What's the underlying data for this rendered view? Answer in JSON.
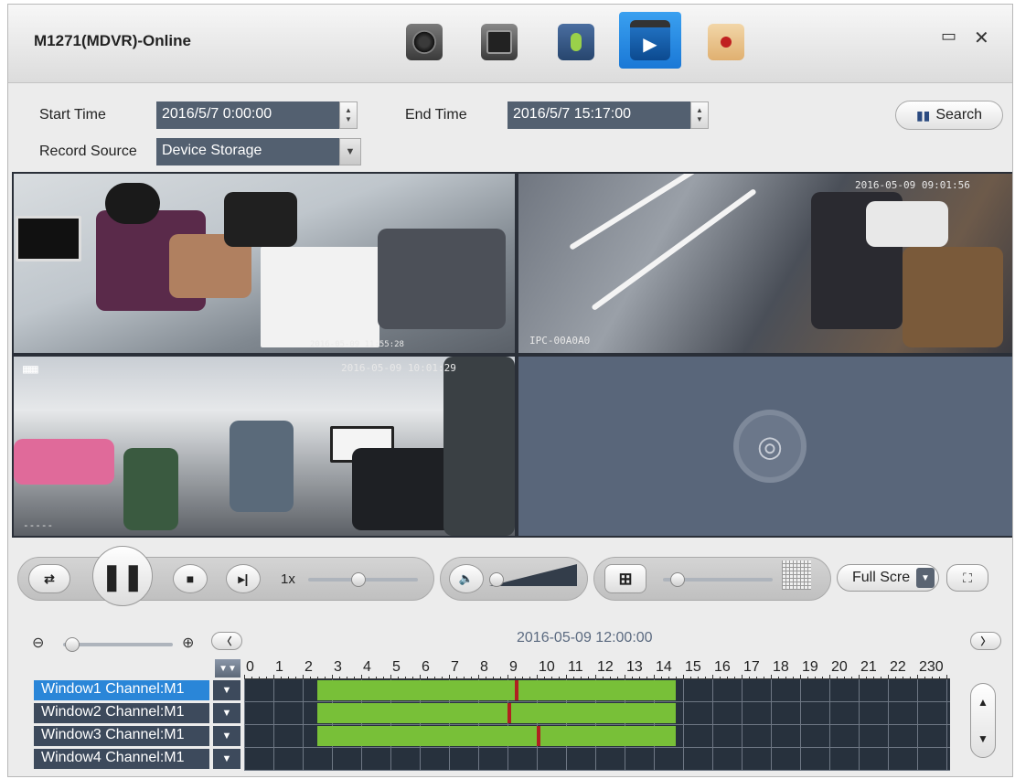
{
  "window": {
    "title": "M1271(MDVR)-Online",
    "maximize_glyph": "▭",
    "close_glyph": "✕"
  },
  "toolbar": {
    "icons": [
      "camera-icon",
      "monitor-icon",
      "microphone-icon",
      "playback-icon",
      "map-icon"
    ],
    "active": "playback-icon"
  },
  "search": {
    "start_label": "Start Time",
    "start_value": "2016/5/7 0:00:00",
    "end_label": "End Time",
    "end_value": "2016/5/7 15:17:00",
    "source_label": "Record Source",
    "source_value": "Device Storage",
    "search_button": "Search"
  },
  "video": {
    "pane1_osd": "2016-05-09 11:55:28",
    "pane2_osd_top": "2016-05-09 09:01:56",
    "pane2_osd_bottom": "IPC-00A0A0",
    "pane3_osd_top": "2016-05-09 10:01:29",
    "pane3_osd_bottom": "-----"
  },
  "controls": {
    "speed_label": "1x",
    "fullscreen_select": "Full Scre",
    "speed_level": 0.45,
    "volume_level": 0.0,
    "zoom_level": 0.08
  },
  "timeline": {
    "datetime": "2016-05-09 12:00:00",
    "hours": [
      "0",
      "1",
      "2",
      "3",
      "4",
      "5",
      "6",
      "7",
      "8",
      "9",
      "10",
      "11",
      "12",
      "13",
      "14",
      "15",
      "16",
      "17",
      "18",
      "19",
      "20",
      "21",
      "22",
      "230"
    ],
    "channels": [
      {
        "label": "Window1 Channel:M1",
        "selected": true,
        "seg_start": 2.5,
        "seg_end": 14.75,
        "cursor": 9.25
      },
      {
        "label": "Window2 Channel:M1",
        "selected": false,
        "seg_start": 2.5,
        "seg_end": 14.75,
        "cursor": 9.0
      },
      {
        "label": "Window3 Channel:M1",
        "selected": false,
        "seg_start": 2.5,
        "seg_end": 14.75,
        "cursor": 10.0
      },
      {
        "label": "Window4 Channel:M1",
        "selected": false,
        "seg_start": null,
        "seg_end": null,
        "cursor": null
      }
    ]
  }
}
